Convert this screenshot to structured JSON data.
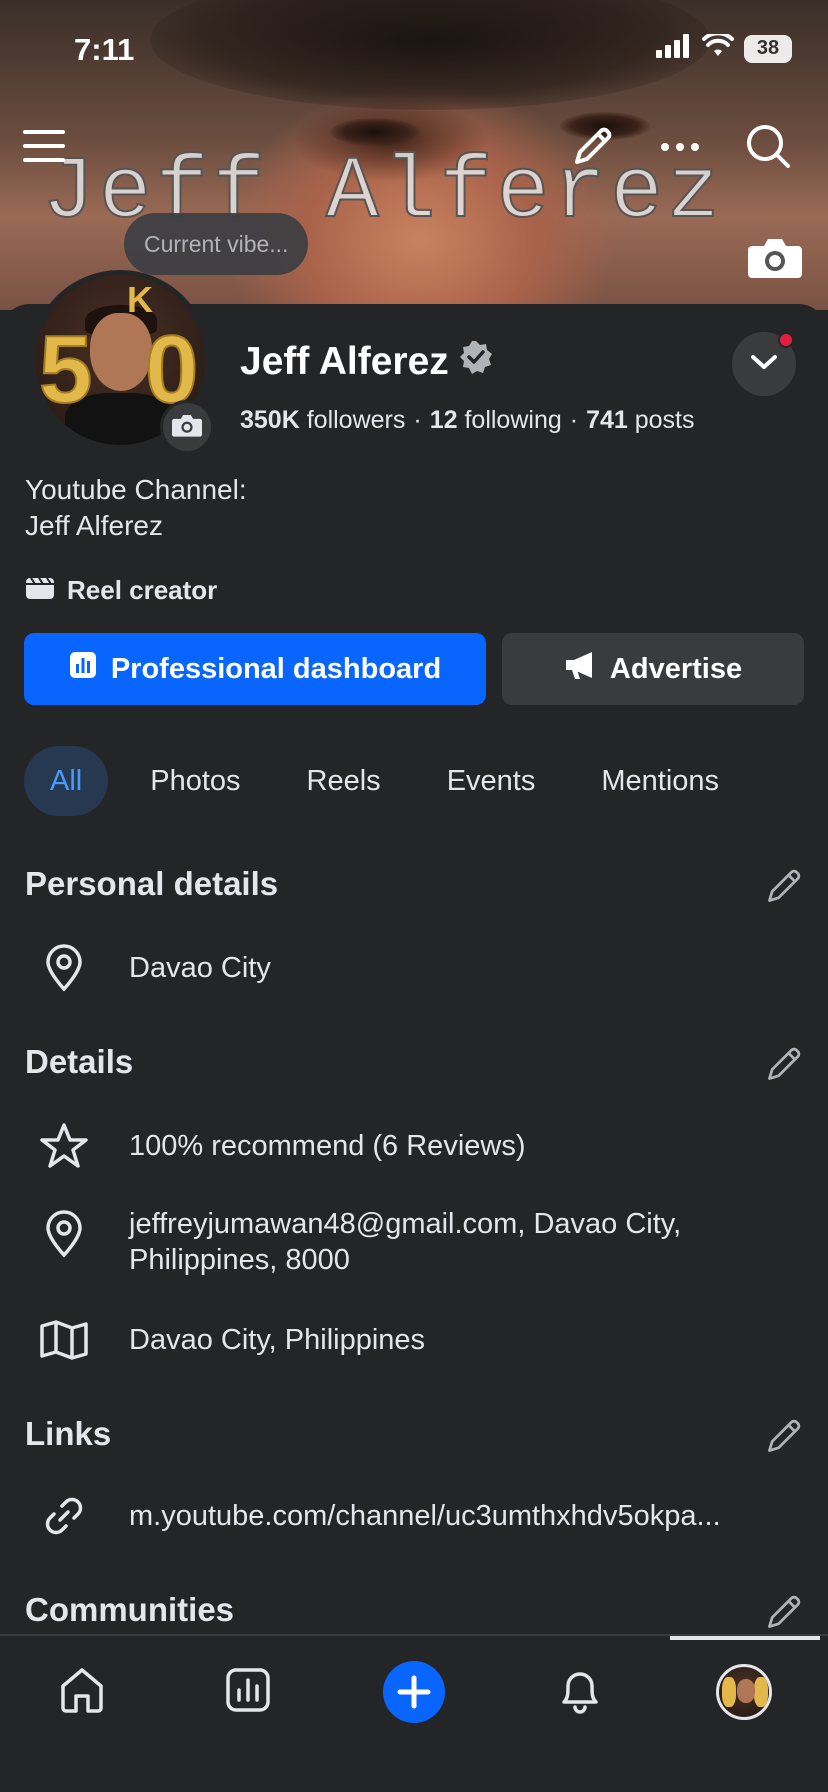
{
  "status_bar": {
    "time": "7:11",
    "battery": "38"
  },
  "cover": {
    "title_text": "Jeff Alferez",
    "vibe_placeholder": "Current vibe..."
  },
  "profile": {
    "name": "Jeff Alferez",
    "followers_count": "350K",
    "followers_label": "followers",
    "following_count": "12",
    "following_label": "following",
    "posts_count": "741",
    "posts_label": "posts",
    "separator": "·",
    "bio": "Youtube Channel:\nJeff Alferez",
    "category": "Reel creator"
  },
  "actions": {
    "dashboard_label": "Professional dashboard",
    "advertise_label": "Advertise"
  },
  "tabs": [
    {
      "label": "All",
      "active": true
    },
    {
      "label": "Photos"
    },
    {
      "label": "Reels"
    },
    {
      "label": "Events"
    },
    {
      "label": "Mentions"
    }
  ],
  "sections": {
    "personal_details": {
      "title": "Personal details",
      "items": [
        {
          "icon": "location-pin-icon",
          "text": "Davao City"
        }
      ]
    },
    "details": {
      "title": "Details",
      "items": [
        {
          "icon": "star-icon",
          "text": "100% recommend (6 Reviews)"
        },
        {
          "icon": "location-pin-icon",
          "text": "jeffreyjumawan48@gmail.com, Davao City,\nPhilippines, 8000"
        },
        {
          "icon": "map-icon",
          "text": "Davao City, Philippines"
        }
      ]
    },
    "links": {
      "title": "Links",
      "items": [
        {
          "icon": "link-icon",
          "text": "m.youtube.com/channel/uc3umthxhdv5okpa..."
        }
      ]
    },
    "communities": {
      "title": "Communities"
    }
  },
  "nav": [
    "home-icon",
    "insights-icon",
    "create-icon",
    "notifications-icon",
    "profile-avatar"
  ],
  "colors": {
    "accent": "#0866ff",
    "background": "#242527",
    "tab_active_bg": "#263951",
    "tab_active_text": "#4a9bff",
    "notification_dot": "#e41e3f"
  }
}
